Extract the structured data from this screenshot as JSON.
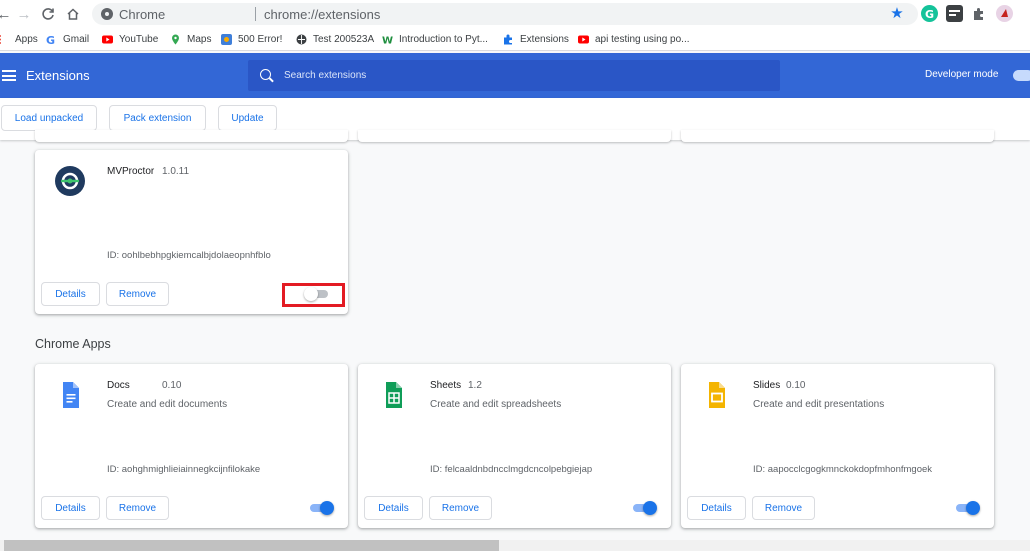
{
  "browser": {
    "omnibox_site": "Chrome",
    "omnibox_url": "chrome://extensions"
  },
  "bookmarks": [
    {
      "label": "Apps",
      "icon": "apps-grid-icon"
    },
    {
      "label": "Gmail",
      "icon": "google-icon"
    },
    {
      "label": "YouTube",
      "icon": "youtube-icon"
    },
    {
      "label": "Maps",
      "icon": "maps-pin-icon"
    },
    {
      "label": "500 Error!",
      "icon": "error-page-icon"
    },
    {
      "label": "Test 200523A",
      "icon": "globe-icon"
    },
    {
      "label": "Introduction to Pyt...",
      "icon": "w-logo-icon"
    },
    {
      "label": "Extensions",
      "icon": "puzzle-icon"
    },
    {
      "label": "api testing using po...",
      "icon": "youtube-icon"
    }
  ],
  "header": {
    "title": "Extensions",
    "search_placeholder": "Search extensions",
    "developer_mode_label": "Developer mode",
    "developer_mode": true
  },
  "dev_toolbar": {
    "load_unpacked": "Load unpacked",
    "pack_extension": "Pack extension",
    "update": "Update"
  },
  "extensions": [
    {
      "name": "MVProctor",
      "version": "1.0.11",
      "description": "",
      "id": "ID: oohlbebhpgkiemcalbjdolaeopnhfblo",
      "enabled": false,
      "highlighted": true
    }
  ],
  "chrome_apps_title": "Chrome Apps",
  "chrome_apps": [
    {
      "name": "Docs",
      "version": "0.10",
      "description": "Create and edit documents",
      "id": "ID: aohghmighlieiainnegkcijnfilokake",
      "enabled": true,
      "color": "#4285f4"
    },
    {
      "name": "Sheets",
      "version": "1.2",
      "description": "Create and edit spreadsheets",
      "id": "ID: felcaaldnbdncclmgdcncolpebgiejap",
      "enabled": true,
      "color": "#0f9d58"
    },
    {
      "name": "Slides",
      "version": "0.10",
      "description": "Create and edit presentations",
      "id": "ID: aapocclcgogkmnckokdopfmhonfmgoek",
      "enabled": true,
      "color": "#f4b400"
    }
  ],
  "card_buttons": {
    "details": "Details",
    "remove": "Remove"
  },
  "colors": {
    "header": "#3367d6",
    "accent": "#1a73e8",
    "highlight": "#e31b23"
  }
}
